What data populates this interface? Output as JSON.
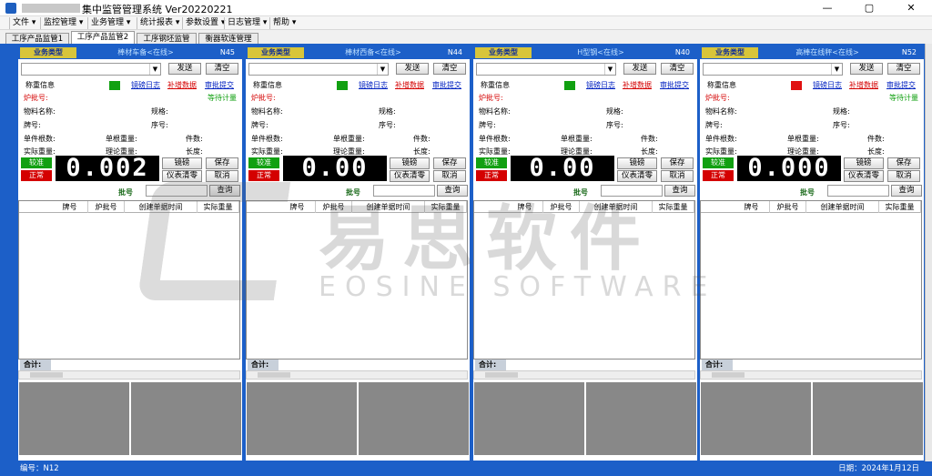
{
  "window": {
    "title": "集中监管管理系统 Ver20220221",
    "minimize": "—",
    "maximize": "▢",
    "close": "✕"
  },
  "menu": [
    "文件 ▾",
    "监控管理 ▾",
    "业务管理 ▾",
    "统计报表 ▾",
    "参数设置 ▾",
    "日志管理 ▾",
    "帮助 ▾"
  ],
  "tabs": [
    {
      "label": "工序产品监管1",
      "active": false
    },
    {
      "label": "工序产品监管2",
      "active": true
    },
    {
      "label": "工序钢坯监管",
      "active": false
    },
    {
      "label": "衡器软连管理",
      "active": false
    }
  ],
  "common": {
    "biz_tag": "业务类型",
    "send": "发送",
    "clear": "清空",
    "weigh_info": "称重信息",
    "link_log": "镜磅日志",
    "link_supplement": "补增数据",
    "link_approve": "审批提交",
    "furnace_batch": "炉批号:",
    "material": "物料名称:",
    "spec": "规格:",
    "brand": "牌号:",
    "serial": "序号:",
    "piece_count": "单件根数:",
    "single_weight": "单根重量:",
    "pieces": "件数:",
    "actual_weight": "实际重量:",
    "theory_weight": "理论重量:",
    "length": "长度:",
    "calibrate": "较准",
    "normal": "正常",
    "lock": "镜磅",
    "save": "保存",
    "reset": "仪表清零",
    "cancel": "取消",
    "batch_label": "批号",
    "query": "查询",
    "columns": [
      "牌号",
      "炉批号",
      "创建单据时间",
      "实际重量"
    ],
    "total": "合计:"
  },
  "panels": [
    {
      "title": "棒材车备<在线>",
      "code": "N45",
      "light": "#11a011",
      "state": "等待计量",
      "display": "0.002"
    },
    {
      "title": "棒材西备<在线>",
      "code": "N44",
      "light": "#11a011",
      "state": "",
      "display": "0.00"
    },
    {
      "title": "H型钢<在线>",
      "code": "N40",
      "light": "#11a011",
      "state": "",
      "display": "0.00"
    },
    {
      "title": "高棒在线秤<在线>",
      "code": "N52",
      "light": "#e01010",
      "state": "等待计量",
      "display": "0.000"
    }
  ],
  "status": {
    "left": "编号：N12",
    "right": "日期：2024年1月12日"
  },
  "watermark": {
    "cn": "易思软件",
    "en": "EOSINE SOFTWARE"
  },
  "colors": {
    "accent": "#1c5fc8",
    "tag": "#d8c53a",
    "ok": "#11a011",
    "alarm": "#d40000"
  }
}
